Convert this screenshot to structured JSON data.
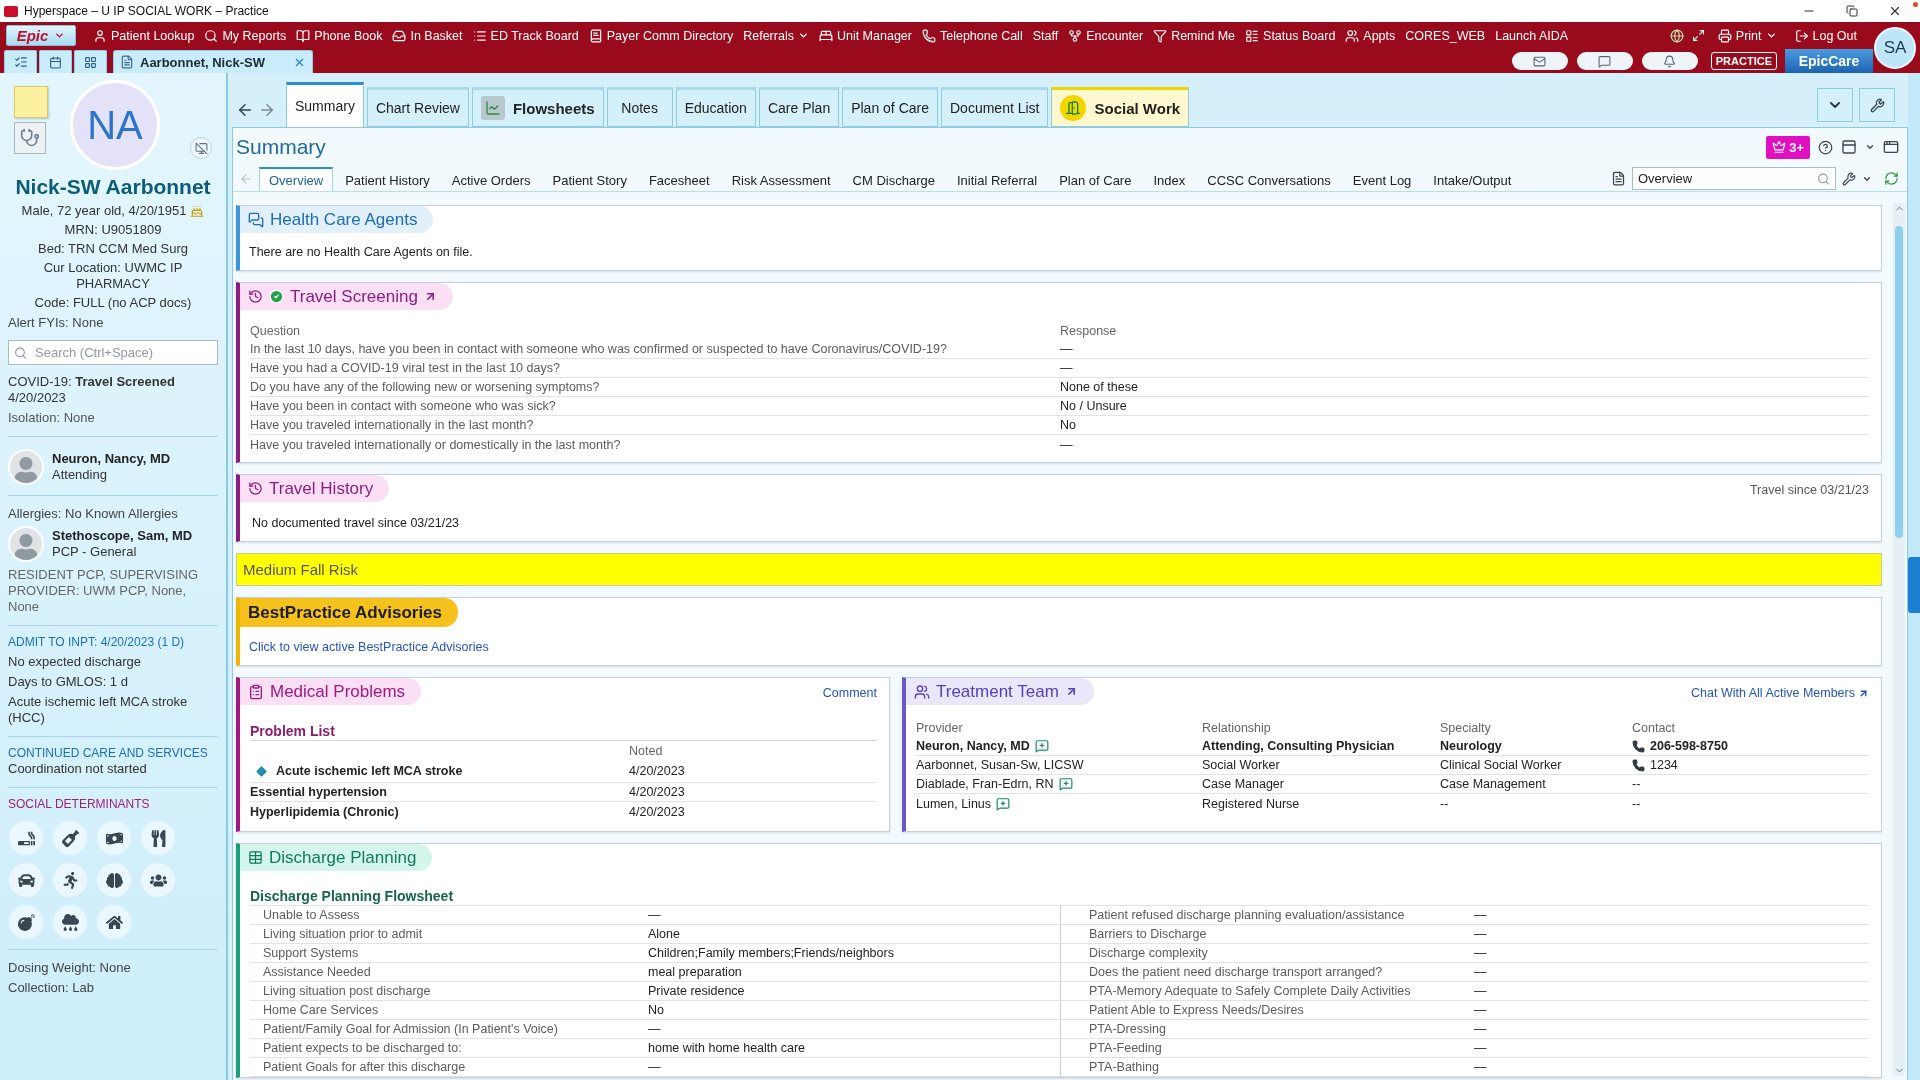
{
  "window": {
    "title": "Hyperspace – U IP SOCIAL WORK – Practice"
  },
  "menu_bar": {
    "logo": "Epic",
    "items": [
      {
        "label": "Patient Lookup",
        "dropdown": false
      },
      {
        "label": "My Reports",
        "dropdown": false
      },
      {
        "label": "Phone Book",
        "dropdown": false
      },
      {
        "label": "In Basket",
        "dropdown": false
      },
      {
        "label": "ED Track Board",
        "dropdown": false
      },
      {
        "label": "Payer Comm Directory",
        "dropdown": false
      },
      {
        "label": "Referrals",
        "dropdown": true
      },
      {
        "label": "Unit Manager",
        "dropdown": false
      },
      {
        "label": "Telephone Call",
        "dropdown": false
      },
      {
        "label": "Staff",
        "dropdown": false
      },
      {
        "label": "Encounter",
        "dropdown": false
      },
      {
        "label": "Remind Me",
        "dropdown": false
      },
      {
        "label": "Status Board",
        "dropdown": false
      },
      {
        "label": "Appts",
        "dropdown": false
      },
      {
        "label": "CORES_WEB",
        "dropdown": false
      },
      {
        "label": "Launch AIDA",
        "dropdown": false
      }
    ],
    "right_items": [
      {
        "label": "Print",
        "dropdown": true
      },
      {
        "label": "Log Out",
        "dropdown": false
      }
    ]
  },
  "patient_bar": {
    "patient_tab": "Aarbonnet, Nick-SW",
    "environment": "PRACTICE",
    "product": "EpicCare",
    "user_initials": "SA"
  },
  "sidebar": {
    "initials": "NA",
    "name": "Nick-SW Aarbonnet",
    "demographics": "Male, 72 year old, 4/20/1951",
    "details": [
      "MRN: U9051809",
      "Bed: TRN CCM Med Surg",
      "Cur Location: UWMC IP PHARMACY",
      "Code: FULL (no ACP docs)"
    ],
    "alert_fyis": "Alert FYIs: None",
    "search": {
      "placeholder": "Search (Ctrl+Space)"
    },
    "covid": "COVID-19: **Travel Screened** 4/20/2023",
    "isolation": "Isolation: None",
    "attending": {
      "name": "Neuron, Nancy, MD",
      "role": "Attending"
    },
    "allergies": "Allergies: No Known Allergies",
    "pcp": {
      "name": "Stethoscope, Sam, MD",
      "role": "PCP - General"
    },
    "resident_pcp": "RESIDENT PCP, SUPERVISING PROVIDER: UWM PCP, None, None",
    "admission": {
      "heading": "ADMIT TO INPT: 4/20/2023 (1 D)",
      "lines": [
        "No expected discharge",
        "Days to GMLOS: 1 d",
        "Acute ischemic left MCA stroke (HCC)"
      ]
    },
    "care_services": {
      "heading": "CONTINUED CARE AND SERVICES",
      "lines": [
        "Coordination not started"
      ]
    },
    "social_determinants": {
      "heading": "SOCIAL DETERMINANTS"
    },
    "footer": [
      "Dosing Weight: None",
      "Collection: Lab"
    ]
  },
  "tabs": [
    {
      "label": "Summary",
      "selected": true,
      "kind": "plain"
    },
    {
      "label": "Chart Review",
      "selected": false,
      "kind": "plain"
    },
    {
      "label": "Flowsheets",
      "selected": false,
      "kind": "tool"
    },
    {
      "label": "Notes",
      "selected": false,
      "kind": "plain"
    },
    {
      "label": "Education",
      "selected": false,
      "kind": "plain"
    },
    {
      "label": "Care Plan",
      "selected": false,
      "kind": "plain"
    },
    {
      "label": "Plan of Care",
      "selected": false,
      "kind": "plain"
    },
    {
      "label": "Document List",
      "selected": false,
      "kind": "plain"
    },
    {
      "label": "Social Work",
      "selected": false,
      "kind": "activity"
    }
  ],
  "summary": {
    "title": "Summary",
    "badge": "3+",
    "subtabs": [
      {
        "label": "Overview",
        "selected": true
      },
      {
        "label": "Patient History",
        "selected": false
      },
      {
        "label": "Active Orders",
        "selected": false
      },
      {
        "label": "Patient Story",
        "selected": false
      },
      {
        "label": "Facesheet",
        "selected": false
      },
      {
        "label": "Risk Assessment",
        "selected": false
      },
      {
        "label": "CM Discharge",
        "selected": false
      },
      {
        "label": "Initial Referral",
        "selected": false
      },
      {
        "label": "Plan of Care",
        "selected": false
      },
      {
        "label": "Index",
        "selected": false
      },
      {
        "label": "CCSC Conversations",
        "selected": false
      },
      {
        "label": "Event Log",
        "selected": false
      },
      {
        "label": "Intake/Output",
        "selected": false
      }
    ],
    "report_search": {
      "value": "Overview"
    }
  },
  "health_care_agents": {
    "title": "Health Care Agents",
    "message": "There are no Health Care Agents on file."
  },
  "travel_screening": {
    "title": "Travel Screening",
    "screened": true,
    "columns": [
      "Question",
      "Response"
    ],
    "rows": [
      {
        "question": "In the last 10 days, have you been in contact with someone who was confirmed or suspected to have Coronavirus/COVID-19?",
        "response": "—"
      },
      {
        "question": "Have you had a COVID-19 viral test in the last 10 days?",
        "response": "—"
      },
      {
        "question": "Do you have any of the following new or worsening symptoms?",
        "response": "None of these"
      },
      {
        "question": "Have you been in contact with someone who was sick?",
        "response": "No / Unsure"
      },
      {
        "question": "Have you traveled internationally in the last month?",
        "response": "No"
      },
      {
        "question": "Have you traveled internationally or domestically in the last month?",
        "response": "—"
      }
    ]
  },
  "travel_history": {
    "title": "Travel History",
    "since": "Travel since 03/21/23",
    "message": "No documented travel since 03/21/23"
  },
  "fall_risk": {
    "label": "Medium Fall Risk"
  },
  "best_practice": {
    "title": "BestPractice Advisories",
    "link": "Click to view active BestPractice Advisories"
  },
  "medical_problems": {
    "title": "Medical Problems",
    "action": "Comment",
    "list_title": "Problem List",
    "noted_header": "Noted",
    "rows": [
      {
        "problem": "Acute ischemic left MCA stroke",
        "noted": "4/20/2023",
        "principal": true
      },
      {
        "problem": "Essential hypertension",
        "noted": "4/20/2023",
        "principal": false
      },
      {
        "problem": "Hyperlipidemia (Chronic)",
        "noted": "4/20/2023",
        "principal": false
      }
    ]
  },
  "treatment_team": {
    "title": "Treatment Team",
    "action": "Chat With All Active Members",
    "columns": [
      "Provider",
      "Relationship",
      "Specialty",
      "Contact"
    ],
    "rows": [
      {
        "provider": "Neuron, Nancy, MD",
        "relationship": "Attending, Consulting Physician",
        "specialty": "Neurology",
        "contact": "206-598-8750",
        "attending": true,
        "chat": true,
        "phone": true
      },
      {
        "provider": "Aarbonnet, Susan-Sw, LICSW",
        "relationship": "Social Worker",
        "specialty": "Clinical Social Worker",
        "contact": "1234",
        "attending": false,
        "chat": false,
        "phone": true
      },
      {
        "provider": "Diablade, Fran-Edrn, RN",
        "relationship": "Case Manager",
        "specialty": "Case Management",
        "contact": "--",
        "attending": false,
        "chat": true,
        "phone": false
      },
      {
        "provider": "Lumen, Linus",
        "relationship": "Registered Nurse",
        "specialty": "--",
        "contact": "--",
        "attending": false,
        "chat": true,
        "phone": false
      }
    ]
  },
  "discharge_planning": {
    "title": "Discharge Planning",
    "subtitle": "Discharge Planning Flowsheet",
    "left": [
      {
        "label": "Unable to Assess",
        "value": "—"
      },
      {
        "label": "Living situation prior to admit",
        "value": "Alone"
      },
      {
        "label": "Support Systems",
        "value": "Children;Family members;Friends/neighbors"
      },
      {
        "label": "Assistance Needed",
        "value": "meal preparation"
      },
      {
        "label": "Living situation post discharge",
        "value": "Private residence"
      },
      {
        "label": "Home Care Services",
        "value": "No"
      },
      {
        "label": "Patient/Family Goal for Admission (In Patient's Voice)",
        "value": "—"
      },
      {
        "label": "Patient expects to be discharged to:",
        "value": "home with home health care"
      },
      {
        "label": "Patient Goals for after this discharge",
        "value": "—"
      }
    ],
    "right": [
      {
        "label": "Patient refused discharge planning evaluation/assistance",
        "value": "—"
      },
      {
        "label": "Barriers to Discharge",
        "value": "—"
      },
      {
        "label": "Discharge complexity",
        "value": "—"
      },
      {
        "label": "Does the patient need discharge transport arranged?",
        "value": "—"
      },
      {
        "label": "PTA-Memory Adequate to Safely Complete Daily Activities",
        "value": "—"
      },
      {
        "label": "Patient Able to Express Needs/Desires",
        "value": "—"
      },
      {
        "label": "PTA-Dressing",
        "value": "—"
      },
      {
        "label": "PTA-Feeding",
        "value": "—"
      },
      {
        "label": "PTA-Bathing",
        "value": "—"
      }
    ]
  }
}
